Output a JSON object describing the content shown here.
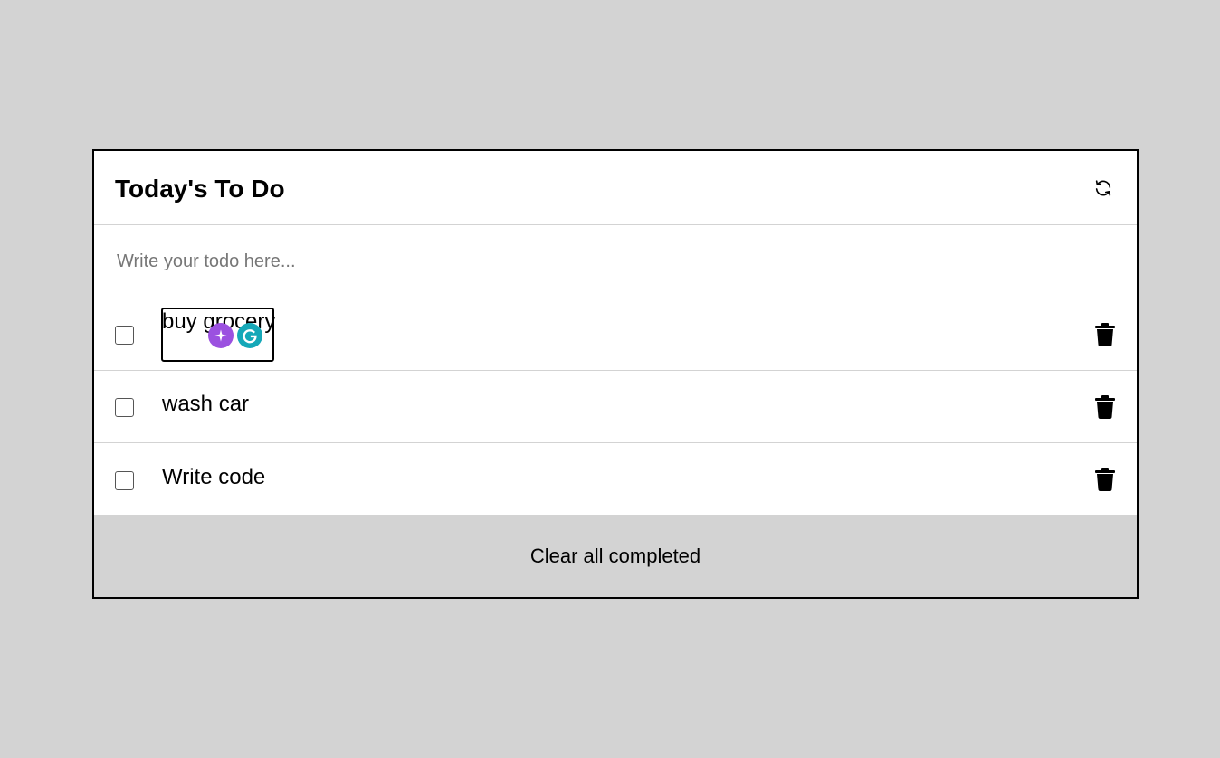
{
  "header": {
    "title": "Today's To Do",
    "refresh_icon": "refresh-icon"
  },
  "new_todo": {
    "placeholder": "Write your todo here...",
    "value": ""
  },
  "todos": [
    {
      "text": "buy grocery",
      "completed": false,
      "editing": true
    },
    {
      "text": "wash car",
      "completed": false,
      "editing": false
    },
    {
      "text": "Write code",
      "completed": false,
      "editing": false
    }
  ],
  "footer": {
    "clear_label": "Clear all completed"
  },
  "icons": {
    "delete": "trash-icon",
    "checkbox": "checkbox-icon",
    "ai_extension": "sparkle-icon",
    "grammar_extension": "grammarly-g-icon"
  },
  "colors": {
    "background": "#d3d3d3",
    "card": "#ffffff",
    "border": "#000000",
    "divider": "#d3d3d3",
    "footer": "#d3d3d3",
    "ai_badge": "#9b51e0",
    "grammar_badge": "#15a8b8"
  }
}
